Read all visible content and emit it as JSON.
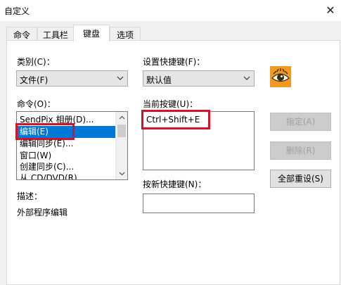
{
  "window": {
    "title": "自定义",
    "close_glyph": "✕"
  },
  "tabs": [
    {
      "label": "命令",
      "active": false
    },
    {
      "label": "工具栏",
      "active": false
    },
    {
      "label": "键盘",
      "active": true
    },
    {
      "label": "选项",
      "active": false
    }
  ],
  "category": {
    "label": "类别(C)：",
    "value": "文件(F)"
  },
  "shortcut_set": {
    "label": "设置快捷键(F)：",
    "value": "默认值"
  },
  "commands": {
    "label": "命令(O)：",
    "items": [
      "SendPix 相册(D)...",
      "编辑(E)",
      "编辑同步(E)...",
      "窗口(W)",
      "创建同步(C)...",
      "从 CD/DVD(R)"
    ],
    "selected_index": 1
  },
  "current_keys": {
    "label": "当前按键(U)：",
    "value": "Ctrl+Shift+E"
  },
  "new_key": {
    "label": "按新快捷键(N)：",
    "value": ""
  },
  "description": {
    "label": "描述：",
    "text": "外部程序编辑"
  },
  "buttons": {
    "assign": "指定(A)",
    "remove": "删除(R)",
    "reset_all": "全部重设(S)"
  },
  "icons": {
    "logo": "eye-logo-icon",
    "dropdown": "chevron-down-icon"
  },
  "colors": {
    "selection": "#0078d7",
    "annotation": "#d0142c",
    "logo_bg": "#f29a1f"
  }
}
